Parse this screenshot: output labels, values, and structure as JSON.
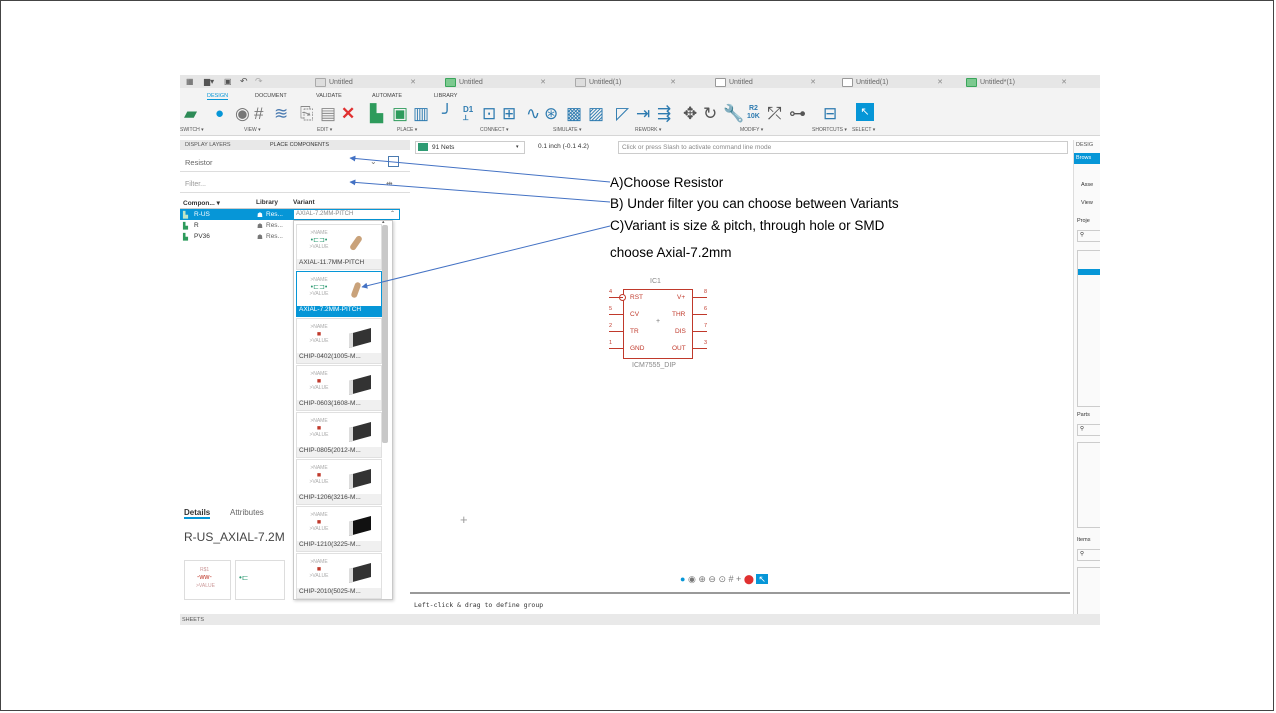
{
  "tabs": [
    {
      "label": "Untitled"
    },
    {
      "label": "Untitled"
    },
    {
      "label": "Untitled(1)"
    },
    {
      "label": "Untitled"
    },
    {
      "label": "Untitled(1)"
    },
    {
      "label": "Untitled*(1)"
    }
  ],
  "ribbon": {
    "tabs": [
      "DESIGN",
      "DOCUMENT",
      "VALIDATE",
      "AUTOMATE",
      "LIBRARY"
    ],
    "groups": [
      "SWITCH ▾",
      "VIEW ▾",
      "EDIT ▾",
      "PLACE ▾",
      "CONNECT ▾",
      "SIMULATE ▾",
      "REWORK ▾",
      "MODIFY ▾",
      "SHORTCUTS ▾",
      "SELECT ▾"
    ],
    "d1": "D1",
    "r2": "R2",
    "r2val": "10K",
    "design_cut": "DESIG",
    "browser_cut": "Brows"
  },
  "left_panel": {
    "tab_display_layers": "DISPLAY LAYERS",
    "tab_place_components": "PLACE COMPONENTS",
    "search_value": "Resistor",
    "filter_placeholder": "Filter...",
    "columns": [
      "Compon... ▾",
      "Library",
      "Variant"
    ],
    "rows": [
      {
        "component": "R-US",
        "library": "Res...",
        "variant": "AXIAL-7.2MM-PITCH"
      },
      {
        "component": "R",
        "library": "Res...",
        "variant": ""
      },
      {
        "component": "PV36",
        "library": "Res...",
        "variant": ""
      }
    ],
    "variants": [
      "AXIAL-11.7MM-PITCH",
      "AXIAL-7.2MM-PITCH",
      "CHIP-0402(1005-M...",
      "CHIP-0603(1608-M...",
      "CHIP-0805(2012-M...",
      "CHIP-1206(3216-M...",
      "CHIP-1210(3225-M...",
      "CHIP-2010(5025-M..."
    ],
    "symbol_name": ">NAME",
    "symbol_value": ">VALUE",
    "details_tab": "Details",
    "attributes_tab": "Attributes",
    "details_title": "R-US_AXIAL-7.2M",
    "thumb_name": "R$1",
    "thumb_value": ">VALUE"
  },
  "toolbar": {
    "nets_label": "91 Nets",
    "grid_label": "0.1 inch (-0.1 4.2)",
    "command_placeholder": "Click or press Slash to activate command line mode"
  },
  "schematic": {
    "ref": "IC1",
    "part_name": "ICM7555_DIP",
    "left_pins": [
      {
        "num": "4",
        "name": "RST"
      },
      {
        "num": "5",
        "name": "CV"
      },
      {
        "num": "2",
        "name": "TR"
      },
      {
        "num": "1",
        "name": "GND"
      }
    ],
    "right_pins": [
      {
        "num": "8",
        "name": "V+"
      },
      {
        "num": "6",
        "name": "THR"
      },
      {
        "num": "7",
        "name": "DIS"
      },
      {
        "num": "3",
        "name": "OUT"
      }
    ]
  },
  "status_bar": {
    "message": "Left-click & drag to define group",
    "sheets": "SHEETS"
  },
  "right_panel": {
    "items": [
      "Asse",
      "View",
      "Proje",
      "Parts",
      "Items"
    ]
  },
  "annotations": {
    "a": "A)Choose Resistor",
    "b": "B) Under filter  you can choose between Variants",
    "c": "C)Variant is size &  pitch, through hole or SMD",
    "d": "choose Axial-7.2mm"
  },
  "colors": {
    "accent": "#0696d7",
    "schematic_red": "#c0392b",
    "annotation_arrow": "#4472c4"
  }
}
